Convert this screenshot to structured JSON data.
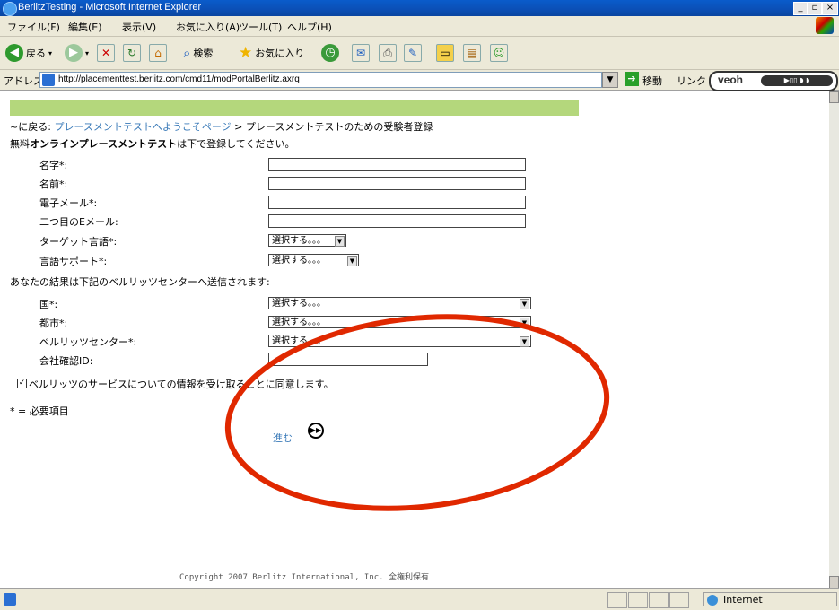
{
  "window": {
    "title": "BerlitzTesting - Microsoft Internet Explorer"
  },
  "menu": [
    "ファイル(F)",
    "編集(E)",
    "表示(V)",
    "お気に入り(A)",
    "ツール(T)",
    "ヘルプ(H)"
  ],
  "toolbar": {
    "back": "戻る",
    "search": "検索",
    "favorites": "お気に入り"
  },
  "address": {
    "label": "アドレス(D)",
    "url": "http://placementtest.berlitz.com/cmd11/modPortalBerlitz.axrq",
    "go": "移動",
    "links": "リンク",
    "addon": "veoh"
  },
  "breadcrumb": {
    "prefix": "~に戻る:",
    "link": "プレースメントテストへようこそページ",
    "current": "> プレースメントテストのための受験者登録"
  },
  "intro": {
    "pre": "無料",
    "bold": "オンラインプレースメントテスト",
    "post": "は下で登録してください。"
  },
  "fields": {
    "last_name": "名字*:",
    "first_name": "名前*:",
    "email": "電子メール*:",
    "email2": "二つ目のEメール:",
    "target_lang": "ターゲット言語*:",
    "lang_support": "言語サポート*:"
  },
  "results_note": "あなたの結果は下記のベルリッツセンターへ送信されます:",
  "location": {
    "country": "国*:",
    "city": "都市*:",
    "center": "ベルリッツセンター*:",
    "company_id": "会社確認ID:"
  },
  "select_placeholder": "選択する。。。",
  "consent": "ベルリッツのサービスについての情報を受け取ることに同意します。",
  "required_note": "* = 必要項目",
  "submit": "進む",
  "copyright": "Copyright 2007 Berlitz International, Inc. 全権利保有",
  "status": {
    "zone": "Internet"
  }
}
